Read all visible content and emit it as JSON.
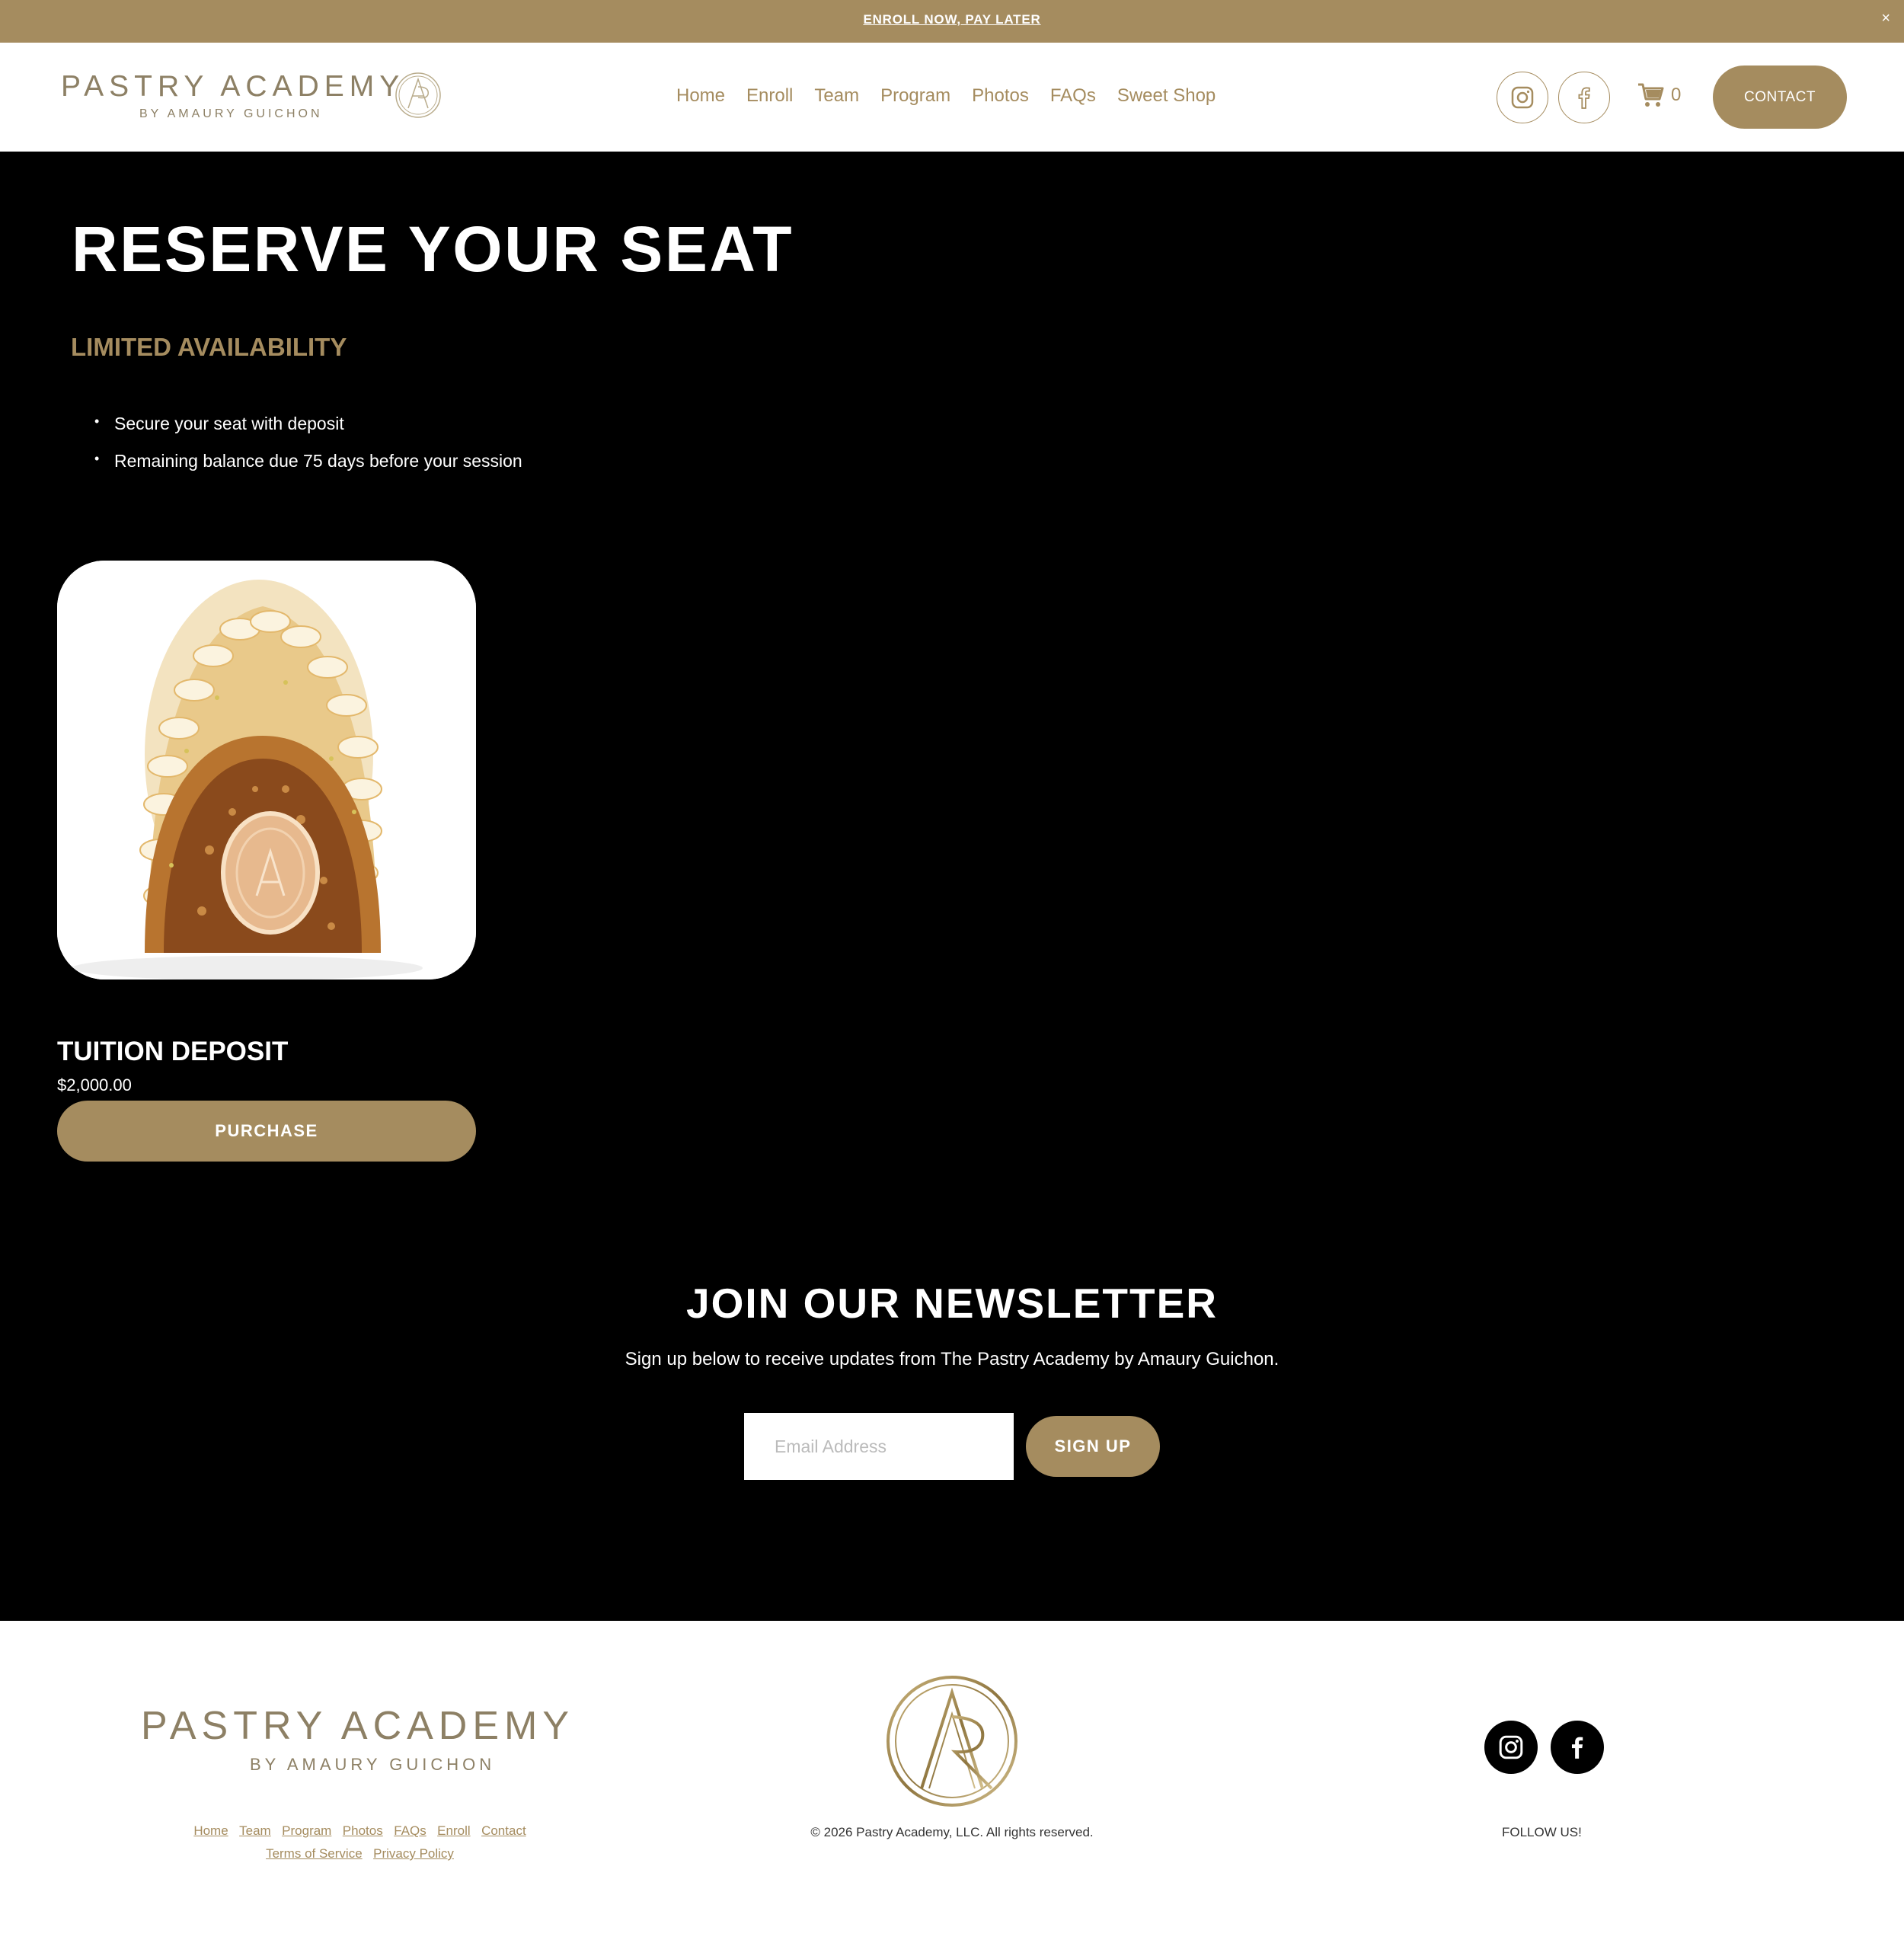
{
  "announcement": {
    "link_text": "ENROLL NOW, PAY LATER",
    "close": "×"
  },
  "header": {
    "logo_title": "PASTRY ACADEMY",
    "logo_subtitle": "BY AMAURY GUICHON",
    "nav": [
      "Home",
      "Enroll",
      "Team",
      "Program",
      "Photos",
      "FAQs",
      "Sweet Shop"
    ],
    "social": [
      "instagram-icon",
      "facebook-icon"
    ],
    "cart_count": "0",
    "contact_label": "CONTACT"
  },
  "hero": {
    "title": "RESERVE YOUR SEAT",
    "subtitle": "LIMITED AVAILABILITY",
    "bullets": [
      "Secure your seat with deposit",
      "Remaining balance due 75 days before your session"
    ]
  },
  "product": {
    "name": "TUITION DEPOSIT",
    "price": "$2,000.00",
    "button": "PURCHASE"
  },
  "newsletter": {
    "title": "JOIN OUR NEWSLETTER",
    "description": "Sign up below to receive updates from The Pastry Academy by Amaury Guichon.",
    "email_placeholder": "Email Address",
    "button": "SIGN UP"
  },
  "footer": {
    "logo_title": "PASTRY ACADEMY",
    "logo_subtitle": "BY AMAURY GUICHON",
    "links_row1": [
      "Home",
      "Team",
      "Program",
      "Photos",
      "FAQs",
      "Enroll",
      "Contact"
    ],
    "links_row2": [
      "Terms of Service",
      "Privacy Policy"
    ],
    "copyright": "© 2026 Pastry Academy, LLC. All rights reserved.",
    "follow_label": "FOLLOW US!"
  },
  "colors": {
    "accent": "#a58c5f",
    "logo_text": "#8d8065",
    "background": "#000000"
  }
}
